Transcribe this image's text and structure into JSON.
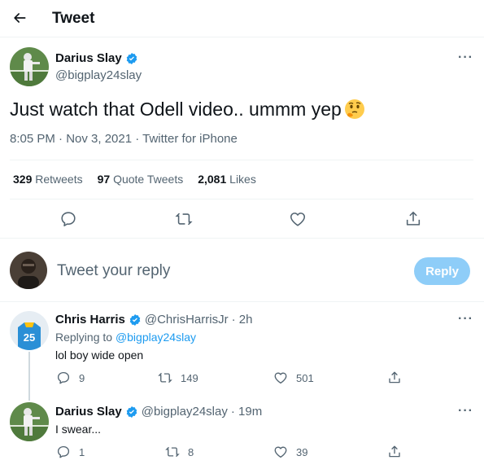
{
  "header": {
    "title": "Tweet"
  },
  "main_tweet": {
    "author_name": "Darius Slay",
    "author_handle": "@bigplay24slay",
    "text": "Just watch that Odell video.. ummm yep",
    "emoji": "thinking-face",
    "meta": "8:05 PM · Nov 3, 2021 · Twitter for iPhone",
    "stats": {
      "retweets_count": "329",
      "retweets_label": "Retweets",
      "quotes_count": "97",
      "quotes_label": "Quote Tweets",
      "likes_count": "2,081",
      "likes_label": "Likes"
    }
  },
  "composer": {
    "placeholder": "Tweet your reply",
    "button_label": "Reply"
  },
  "replies": [
    {
      "author_name": "Chris Harris",
      "author_handle": "@ChrisHarrisJr",
      "time": "· 2h",
      "replying_prefix": "Replying to",
      "replying_to": "@bigplay24slay",
      "text": "lol boy wide open",
      "reply_count": "9",
      "retweet_count": "149",
      "like_count": "501"
    },
    {
      "author_name": "Darius Slay",
      "author_handle": "@bigplay24slay",
      "time": "· 19m",
      "text": "I swear...",
      "reply_count": "1",
      "retweet_count": "8",
      "like_count": "39"
    }
  ],
  "colors": {
    "accent": "#1d9bf0",
    "reply_button": "#8ecdf8",
    "muted": "#536471"
  }
}
